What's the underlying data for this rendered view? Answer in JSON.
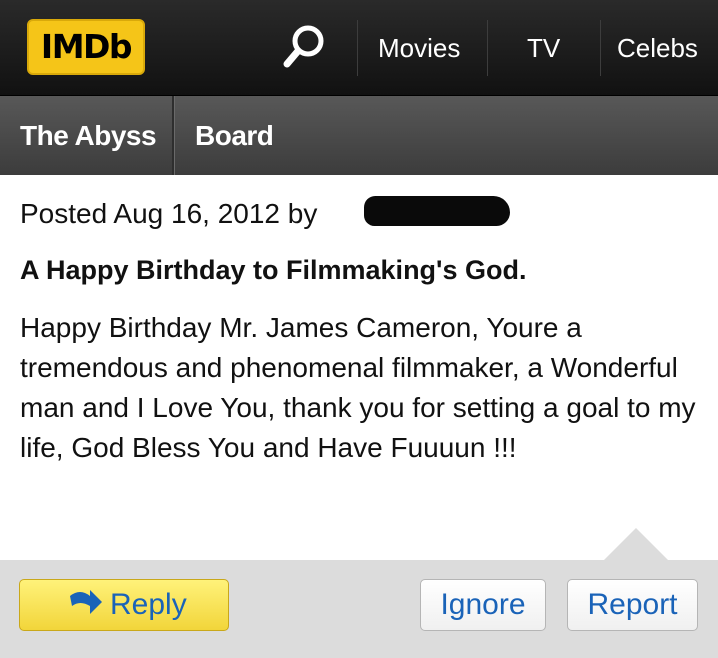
{
  "header": {
    "logo_text": "IMDb",
    "nav": [
      {
        "label": "Movies"
      },
      {
        "label": "TV"
      },
      {
        "label": "Celebs"
      }
    ],
    "search_icon": "search-icon"
  },
  "subnav": {
    "items": [
      {
        "label": "The Abyss"
      },
      {
        "label": "Board"
      }
    ]
  },
  "post": {
    "meta": "Posted Aug 16, 2012 by",
    "title": "A Happy Birthday to Filmmaking's God.",
    "body": "Happy Birthday Mr. James Cameron, Youre a tremendous and phenomenal filmmaker, a Wonderful man and I Love You, thank you for setting a goal to my life, God Bless You and Have Fuuuun !!!"
  },
  "actions": {
    "reply": "Reply",
    "ignore": "Ignore",
    "report": "Report",
    "reply_icon": "curved-arrow-icon"
  },
  "colors": {
    "brand": "#f5c518",
    "link": "#1a63b8",
    "reply_button": "#f7e25a"
  }
}
